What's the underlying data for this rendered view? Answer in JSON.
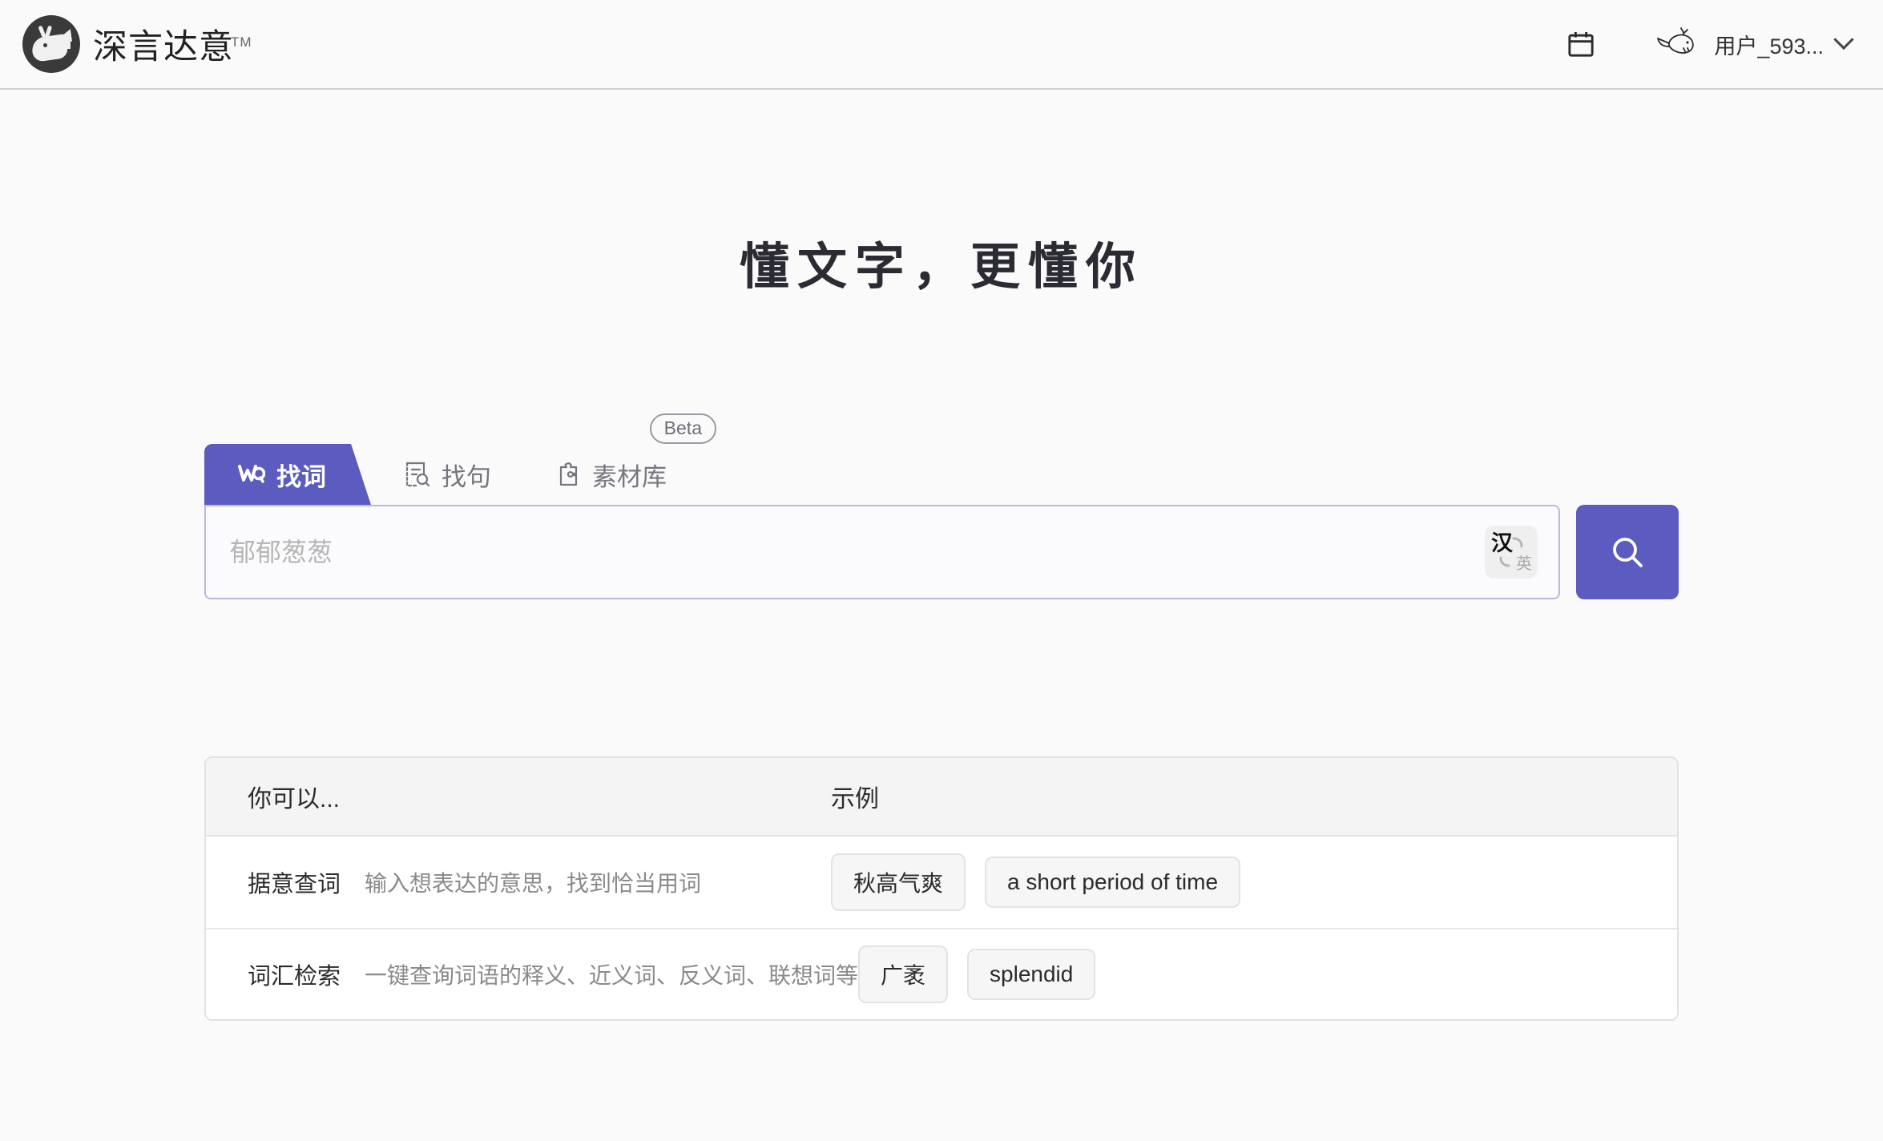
{
  "header": {
    "brand_name": "深言达意",
    "trademark": "TM",
    "logo_icon": "whale-logo-icon",
    "calendar_icon": "calendar-icon",
    "avatar_icon": "whale-avatar-icon",
    "user_name": "用户_593...",
    "caret_icon": "chevron-down-icon"
  },
  "hero": {
    "title": "懂文字，更懂你"
  },
  "search": {
    "tabs": [
      {
        "label": "找词",
        "icon": "word-search-icon",
        "active": true,
        "badge": null
      },
      {
        "label": "找句",
        "icon": "document-search-icon",
        "active": false,
        "badge": null
      },
      {
        "label": "素材库",
        "icon": "material-library-icon",
        "active": false,
        "badge": "Beta"
      }
    ],
    "placeholder": "郁郁葱葱",
    "value": "",
    "lang_toggle": {
      "primary": "汉",
      "secondary": "英",
      "icon": "language-swap-icon"
    },
    "submit_icon": "search-icon"
  },
  "info_table": {
    "headers": [
      "你可以...",
      "示例"
    ],
    "rows": [
      {
        "title": "据意查词",
        "desc": "输入想表达的意思，找到恰当用词",
        "examples": [
          "秋高气爽",
          "a short period of time"
        ]
      },
      {
        "title": "词汇检索",
        "desc": "一键查询词语的释义、近义词、反义词、联想词等",
        "examples": [
          "广袤",
          "splendid"
        ]
      }
    ]
  },
  "colors": {
    "accent": "#5b5bc0",
    "page_bg": "#fafafa",
    "border": "#e2e2e2",
    "muted_text": "#8a8a8a"
  }
}
